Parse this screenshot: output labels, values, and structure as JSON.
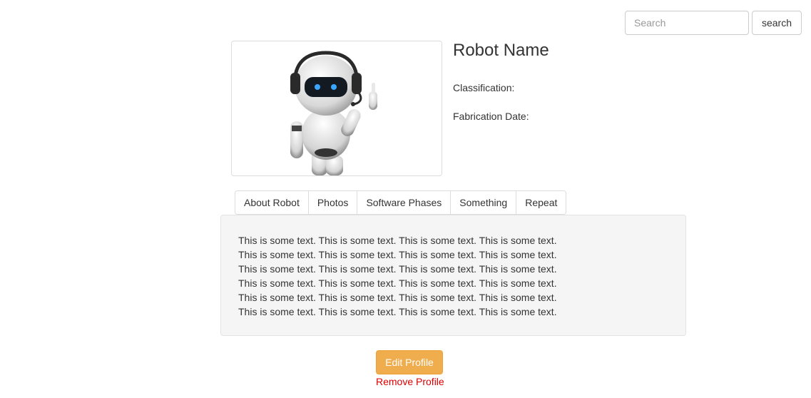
{
  "search": {
    "placeholder": "Search",
    "value": "",
    "button_label": "search"
  },
  "profile": {
    "name": "Robot Name",
    "classification_label": "Classification:",
    "fabrication_label": "Fabrication Date:",
    "image_icon": "robot-image"
  },
  "tabs": [
    {
      "label": "About Robot"
    },
    {
      "label": "Photos"
    },
    {
      "label": "Software Phases"
    },
    {
      "label": "Something"
    },
    {
      "label": "Repeat"
    }
  ],
  "content": {
    "lines": [
      "This is some text. This is some text. This is some text. This is some text.",
      "This is some text. This is some text. This is some text. This is some text.",
      "This is some text. This is some text. This is some text. This is some text.",
      "This is some text. This is some text. This is some text. This is some text.",
      "This is some text. This is some text. This is some text. This is some text.",
      "This is some text. This is some text. This is some text. This is some text."
    ]
  },
  "actions": {
    "edit_label": "Edit Profile",
    "remove_label": "Remove Profile"
  },
  "colors": {
    "edit_button": "#f0ad4e",
    "remove_link": "#dd0000",
    "well_background": "#f5f5f5"
  }
}
